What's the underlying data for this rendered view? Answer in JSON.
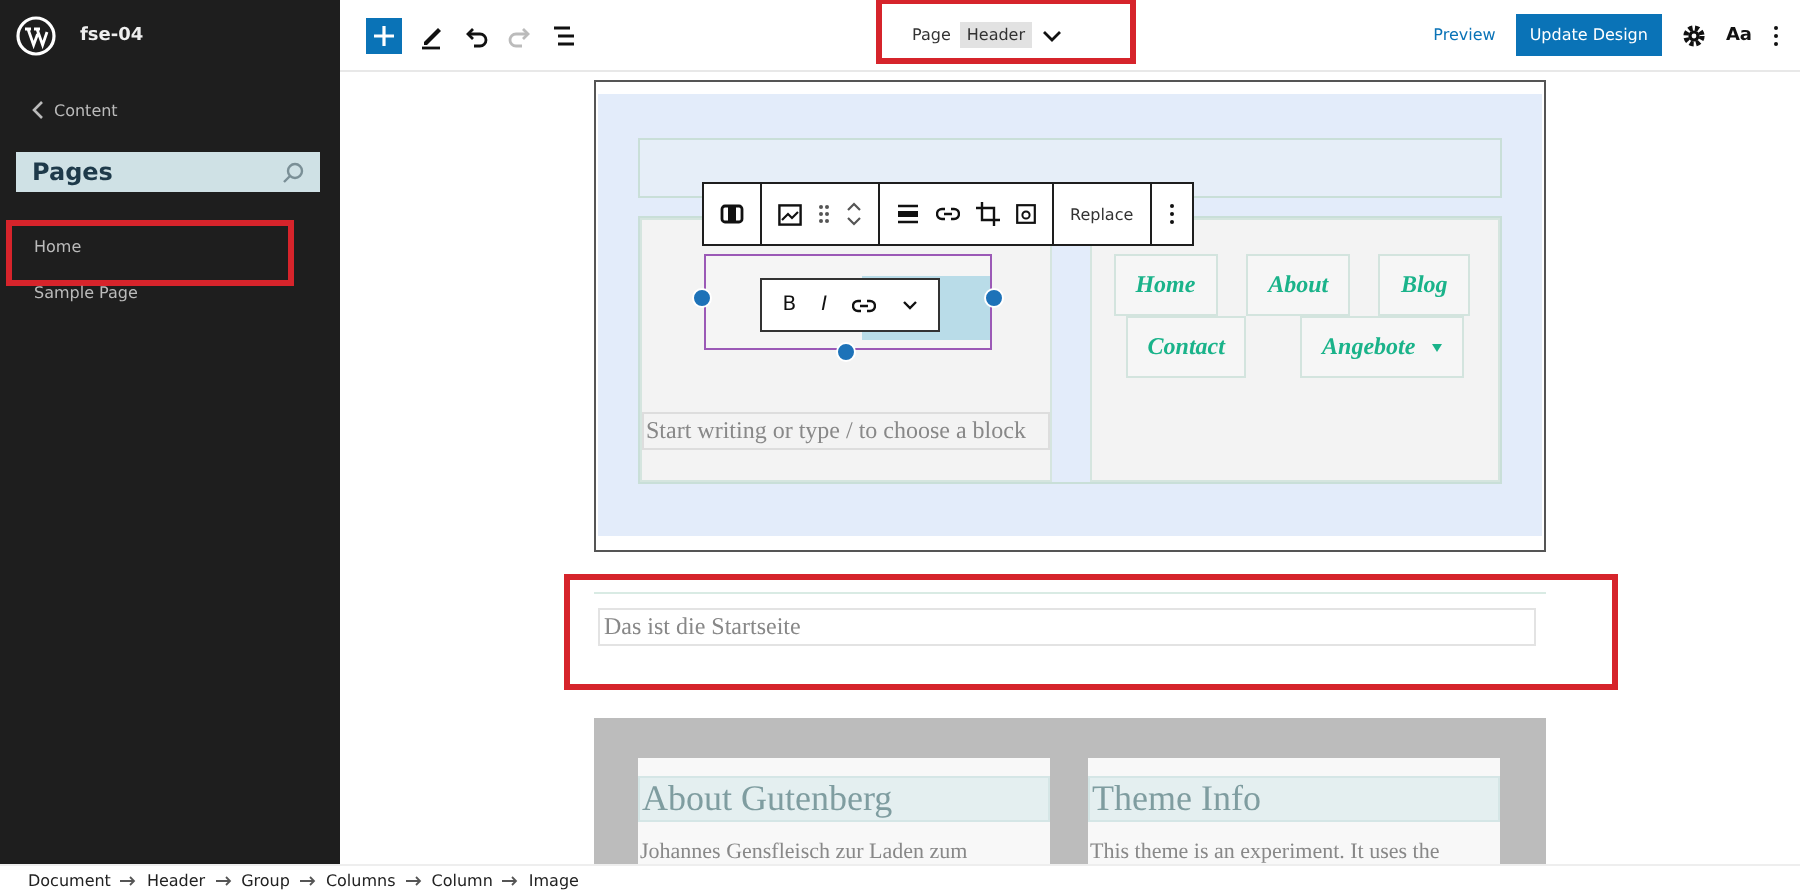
{
  "sidebar": {
    "site_title": "fse-04",
    "back_link": "Content",
    "search": {
      "value": "Pages"
    },
    "items": [
      {
        "label": "Home",
        "highlighted": true
      },
      {
        "label": "Sample Page",
        "highlighted": false
      }
    ]
  },
  "toolbar": {
    "document_title": {
      "type_label": "Page",
      "template": "Header",
      "highlighted": true
    },
    "preview": "Preview",
    "update_button": "Update Design",
    "styles_button": "Aa"
  },
  "block_toolbar": {
    "replace": "Replace"
  },
  "format_toolbar": {
    "bold": "B",
    "italic": "I"
  },
  "navigation": [
    {
      "label": "Home",
      "submenu": false
    },
    {
      "label": "About",
      "submenu": false
    },
    {
      "label": "Blog",
      "submenu": false
    },
    {
      "label": "Contact",
      "submenu": false
    },
    {
      "label": "Angebote",
      "submenu": true
    }
  ],
  "header_placeholder": "Start writing or type / to choose a block",
  "page_content": {
    "text": "Das ist die Startseite",
    "highlighted": true
  },
  "cards": [
    {
      "heading": "About Gutenberg",
      "text": "Johannes Gensfleisch zur Laden zum"
    },
    {
      "heading": "Theme Info",
      "text": "This theme is an experiment. It uses the"
    }
  ],
  "breadcrumb": [
    "Document",
    "Header",
    "Group",
    "Columns",
    "Column",
    "Image"
  ]
}
